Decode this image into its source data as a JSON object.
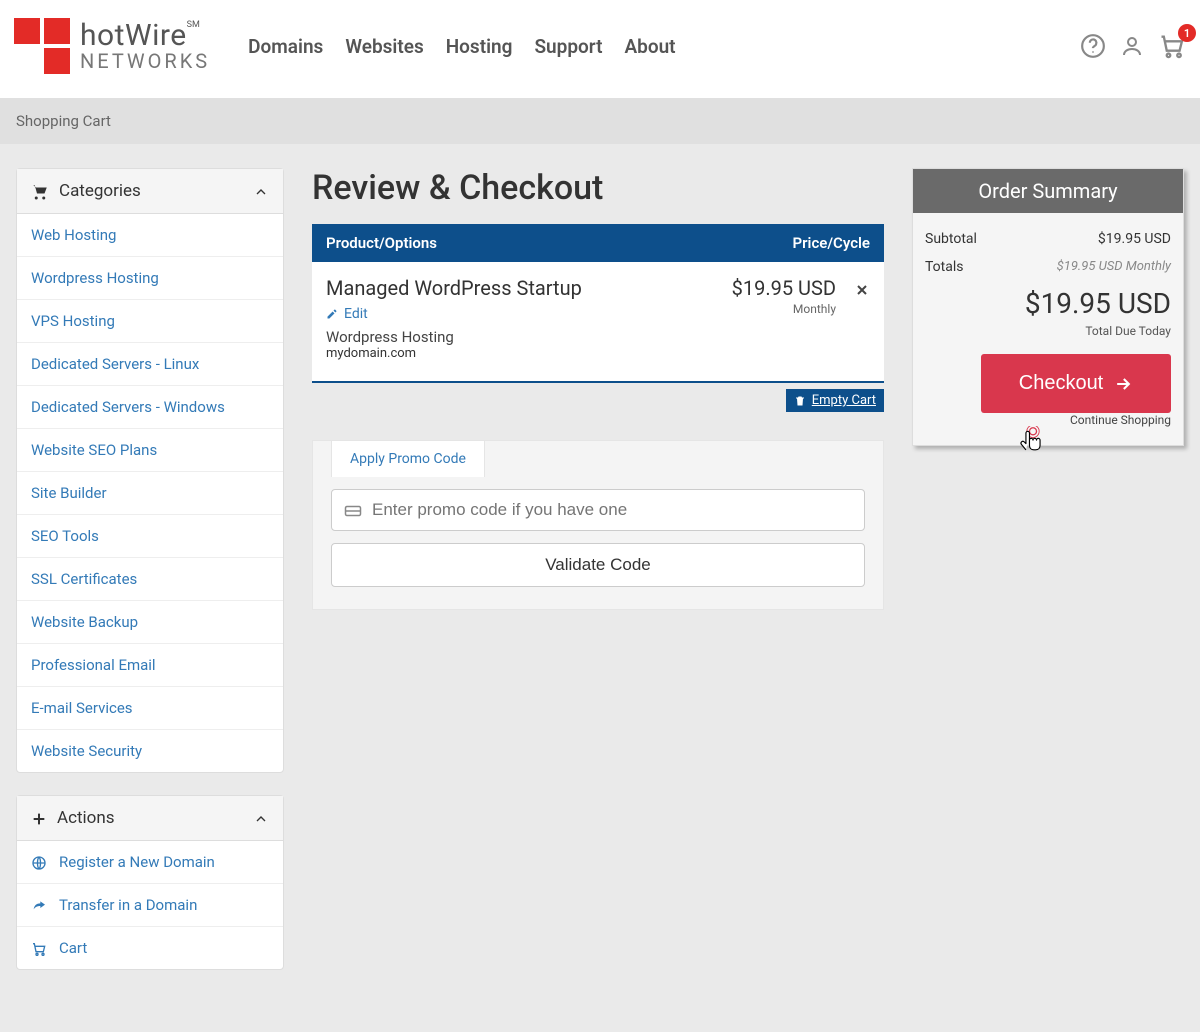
{
  "brand": {
    "name": "hotWire",
    "sm": "SM",
    "sub": "NETWORKS"
  },
  "nav": {
    "items": [
      "Domains",
      "Websites",
      "Hosting",
      "Support",
      "About"
    ]
  },
  "cart_count": "1",
  "breadcrumb": "Shopping Cart",
  "sidebar": {
    "categories_title": "Categories",
    "categories": [
      "Web Hosting",
      "Wordpress Hosting",
      "VPS Hosting",
      "Dedicated Servers - Linux",
      "Dedicated Servers - Windows",
      "Website SEO Plans",
      "Site Builder",
      "SEO Tools",
      "SSL Certificates",
      "Website Backup",
      "Professional Email",
      "E-mail Services",
      "Website Security"
    ],
    "actions_title": "Actions",
    "actions": [
      {
        "label": "Register a New Domain",
        "icon": "globe"
      },
      {
        "label": "Transfer in a Domain",
        "icon": "share"
      },
      {
        "label": "Cart",
        "icon": "cart"
      }
    ]
  },
  "page_title": "Review & Checkout",
  "table": {
    "col_product": "Product/Options",
    "col_price": "Price/Cycle",
    "item": {
      "name": "Managed WordPress Startup",
      "edit": "Edit",
      "category": "Wordpress Hosting",
      "domain": "mydomain.com",
      "price": "$19.95 USD",
      "cycle": "Monthly"
    },
    "empty": "Empty Cart"
  },
  "promo": {
    "tab": "Apply Promo Code",
    "placeholder": "Enter promo code if you have one",
    "validate": "Validate Code"
  },
  "summary": {
    "title": "Order Summary",
    "subtotal_label": "Subtotal",
    "subtotal_value": "$19.95 USD",
    "totals_label": "Totals",
    "totals_value": "$19.95 USD Monthly",
    "grand": "$19.95 USD",
    "due_label": "Total Due Today",
    "checkout": "Checkout",
    "continue": "Continue Shopping"
  }
}
